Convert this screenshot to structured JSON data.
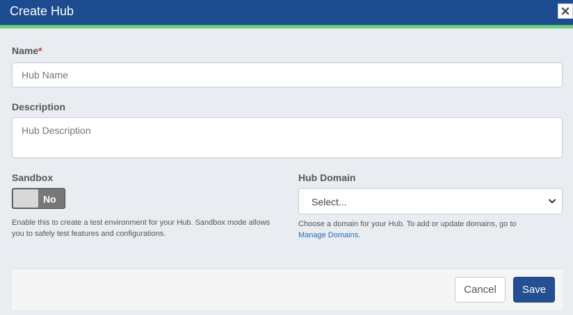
{
  "dialog": {
    "title": "Create Hub",
    "close_icon": "close-icon"
  },
  "form": {
    "name": {
      "label": "Name",
      "required_marker": "*",
      "placeholder": "Hub Name",
      "value": ""
    },
    "description": {
      "label": "Description",
      "placeholder": "Hub Description",
      "value": ""
    },
    "sandbox": {
      "label": "Sandbox",
      "toggle_text": "No",
      "enabled": false,
      "help": "Enable this to create a test environment for your Hub. Sandbox mode allows you to safely test features and configurations."
    },
    "hub_domain": {
      "label": "Hub Domain",
      "selected": "Select...",
      "help_prefix": "Choose a domain for your Hub. To add or update domains, go to",
      "help_link": "Manage Domains",
      "help_suffix": "."
    }
  },
  "footer": {
    "cancel_label": "Cancel",
    "save_label": "Save"
  },
  "colors": {
    "header_bg": "#1c4b8f",
    "accent_stripe": "#6fcf7a",
    "primary_button": "#234f93",
    "required": "#c0392b",
    "link": "#2a6db0"
  }
}
